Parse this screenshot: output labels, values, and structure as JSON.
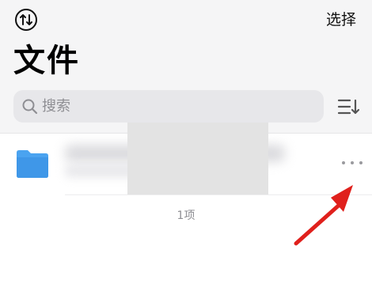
{
  "header": {
    "select_label": "选择",
    "title": "文件",
    "sort_icon": "sort-arrows-circle-icon"
  },
  "search": {
    "placeholder": "搜索",
    "icon": "magnifier-icon",
    "sort_list_icon": "sort-list-icon"
  },
  "files": [
    {
      "icon": "folder-icon",
      "name": "",
      "meta": "",
      "more_icon": "ellipsis-icon"
    }
  ],
  "footer": {
    "count_label": "1项"
  },
  "colors": {
    "header_bg": "#f5f5f6",
    "search_bg": "#e7e7ea",
    "folder_blue": "#4aa3f0",
    "arrow_red": "#e0201c"
  }
}
